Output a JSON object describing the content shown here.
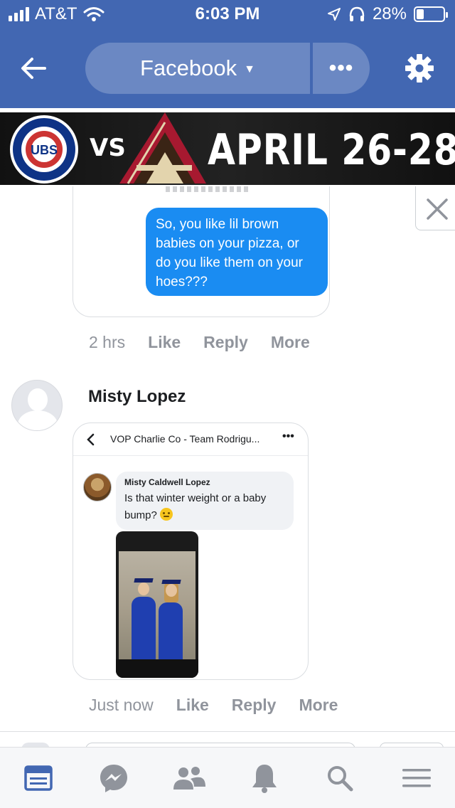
{
  "status_bar": {
    "carrier": "AT&T",
    "time": "6:03 PM",
    "battery_percent": "28%",
    "battery_level": 0.28
  },
  "nav": {
    "title": "Facebook",
    "more_label": "•••"
  },
  "ad_banner": {
    "team_logo_text": "UBS",
    "vs_label": "VS",
    "date_text": "APRIL 26-28"
  },
  "comments": [
    {
      "image_message": "So, you like lil brown babies on your pizza, or do you like them on your hoes???",
      "time": "2 hrs",
      "like_label": "Like",
      "reply_label": "Reply",
      "more_label": "More"
    },
    {
      "author": "Misty Lopez",
      "screenshot": {
        "thread_title": "VOP Charlie Co - Team Rodrigu...",
        "more_label": "•••",
        "inner_author": "Misty Caldwell Lopez",
        "inner_text": "Is that winter weight or a baby bump?"
      },
      "time": "Just now",
      "like_label": "Like",
      "reply_label": "Reply",
      "more_label": "More"
    }
  ],
  "colors": {
    "facebook_blue": "#4267b2",
    "messenger_blue": "#1a8cf2",
    "muted_text": "#90949c"
  },
  "tabs": [
    {
      "icon": "news-feed-icon"
    },
    {
      "icon": "messenger-icon"
    },
    {
      "icon": "friends-icon"
    },
    {
      "icon": "notifications-bell-icon"
    },
    {
      "icon": "search-icon"
    },
    {
      "icon": "menu-icon"
    }
  ]
}
